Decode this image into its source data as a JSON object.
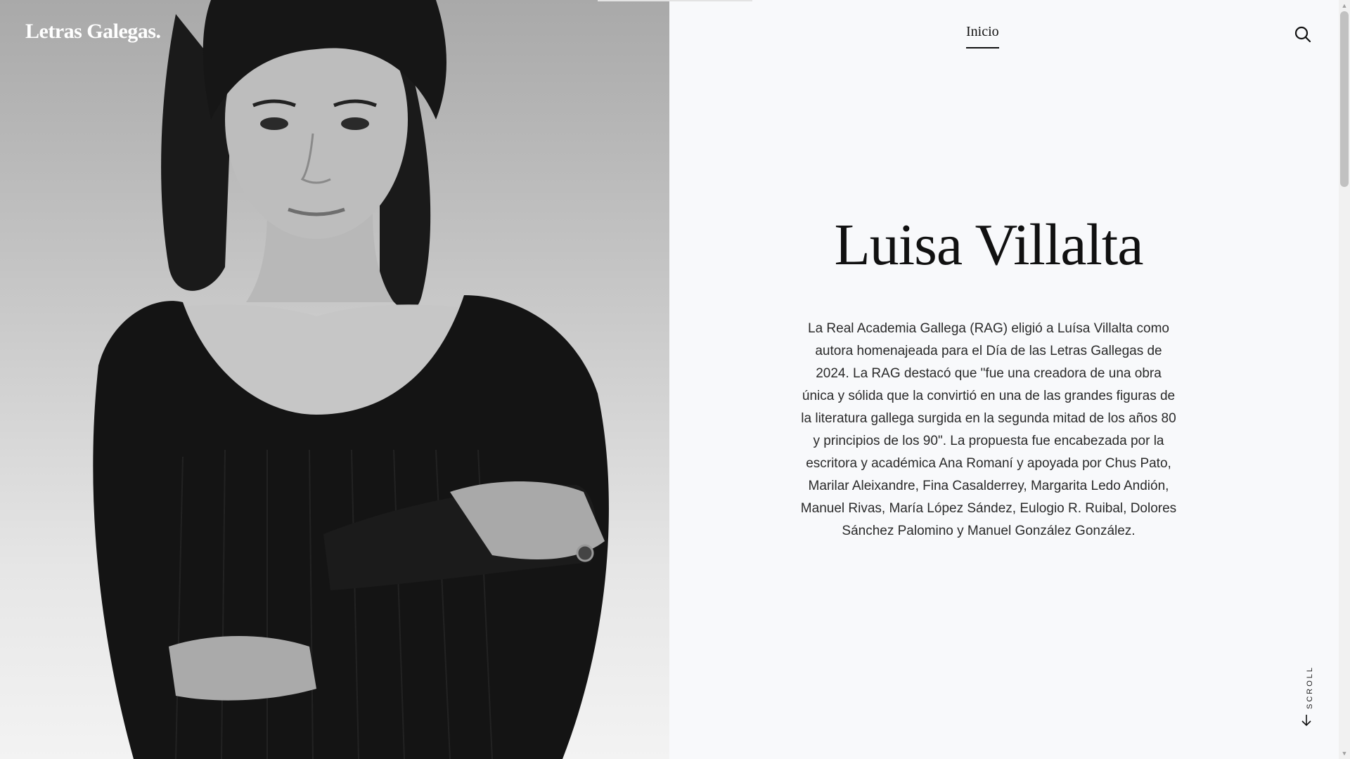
{
  "site": {
    "logo": "Letras Galegas."
  },
  "nav": {
    "items": [
      {
        "label": "Inicio",
        "active": true
      }
    ],
    "search_icon": "search-icon"
  },
  "hero": {
    "title": "Luisa Villalta",
    "body": "La Real Academia Gallega (RAG) eligió a Luísa Villalta como autora homenajeada para el Día de las Letras Gallegas de 2024. La RAG destacó que \"fue una creadora de una obra única y sólida que la convirtió en una de las grandes figuras de la literatura gallega surgida en la segunda mitad de los años 80 y principios de los 90\". La propuesta fue encabezada por la escritora y académica Ana Romaní y apoyada por Chus Pato, Marilar Aleixandre, Fina Casalderrey, Margarita Ledo Andión, Manuel Rivas, María López Sández, Eulogio R. Ruibal, Dolores Sánchez Palomino y Manuel González González.",
    "image_description_icon": "portrait-photo"
  },
  "scroll_indicator": {
    "label": "SCROLL",
    "icon": "arrow-down-icon"
  },
  "colors": {
    "background": "#f8f9fb",
    "text": "#111111",
    "logo": "#ffffff"
  }
}
